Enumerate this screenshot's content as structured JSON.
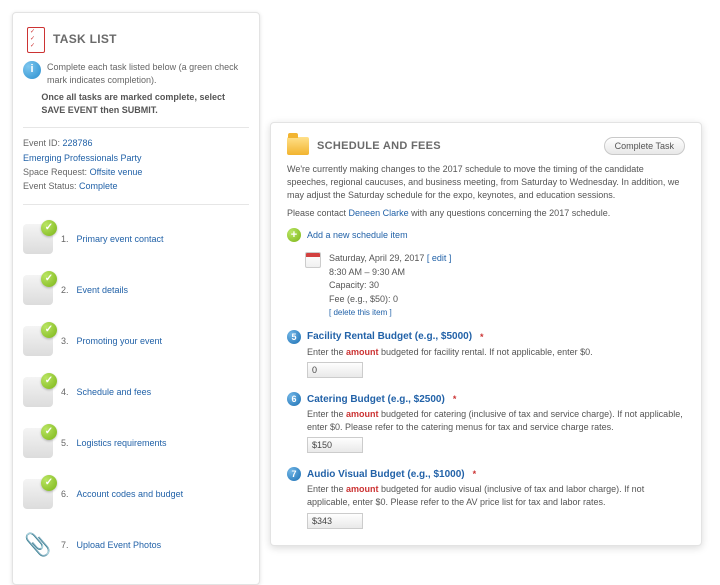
{
  "left": {
    "title": "TASK LIST",
    "note1": "Complete each task listed below (a green check mark indicates completion).",
    "note2": "Once all tasks are marked complete, select SAVE EVENT then SUBMIT.",
    "event_id_label": "Event ID:",
    "event_id": "228786",
    "event_name": "Emerging Professionals Party",
    "space_req_label": "Space Request:",
    "space_req": "Offsite venue",
    "status_label": "Event Status:",
    "status": "Complete",
    "tasks": [
      {
        "n": "1.",
        "label": "Primary event contact"
      },
      {
        "n": "2.",
        "label": "Event details"
      },
      {
        "n": "3.",
        "label": "Promoting your event"
      },
      {
        "n": "4.",
        "label": "Schedule and fees"
      },
      {
        "n": "5.",
        "label": "Logistics requirements"
      },
      {
        "n": "6.",
        "label": "Account codes and budget"
      },
      {
        "n": "7.",
        "label": "Upload Event Photos"
      }
    ]
  },
  "right": {
    "title": "SCHEDULE AND FEES",
    "complete_btn": "Complete Task",
    "intro": "We're currently making changes to the 2017 schedule to move the timing of the candidate speeches, regional caucuses, and business meeting, from Saturday to Wednesday. In addition, we may adjust the Saturday schedule for the expo, keynotes, and education sessions.",
    "contact_pre": "Please contact ",
    "contact_name": "Deneen Clarke",
    "contact_post": " with any questions concerning the 2017 schedule.",
    "add_new": "Add a new schedule item",
    "sched": {
      "date": "Saturday, April 29, 2017",
      "edit": "[ edit ]",
      "time": "8:30 AM – 9:30 AM",
      "cap": "Capacity: 30",
      "fee": "Fee (e.g., $50): 0",
      "del": "[ delete this item ]"
    },
    "q5": {
      "num": "5",
      "title": "Facility Rental Budget (e.g., $5000)",
      "desc_a": "Enter the ",
      "desc_b": " budgeted for facility rental. If not applicable, enter $0.",
      "value": "0"
    },
    "q6": {
      "num": "6",
      "title": "Catering Budget (e.g., $2500)",
      "desc_a": "Enter the ",
      "desc_b": " budgeted for catering (inclusive of tax and service charge). If not applicable, enter $0. Please refer to the catering menus for tax and service charge rates.",
      "value": "$150"
    },
    "q7": {
      "num": "7",
      "title": "Audio Visual Budget (e.g., $1000)",
      "desc_a": "Enter the ",
      "desc_b": " budgeted for audio visual (inclusive of tax and labor charge). If not applicable, enter $0. Please refer to the AV price list for tax and labor rates.",
      "value": "$343"
    },
    "amount_word": "amount",
    "star": "*"
  }
}
